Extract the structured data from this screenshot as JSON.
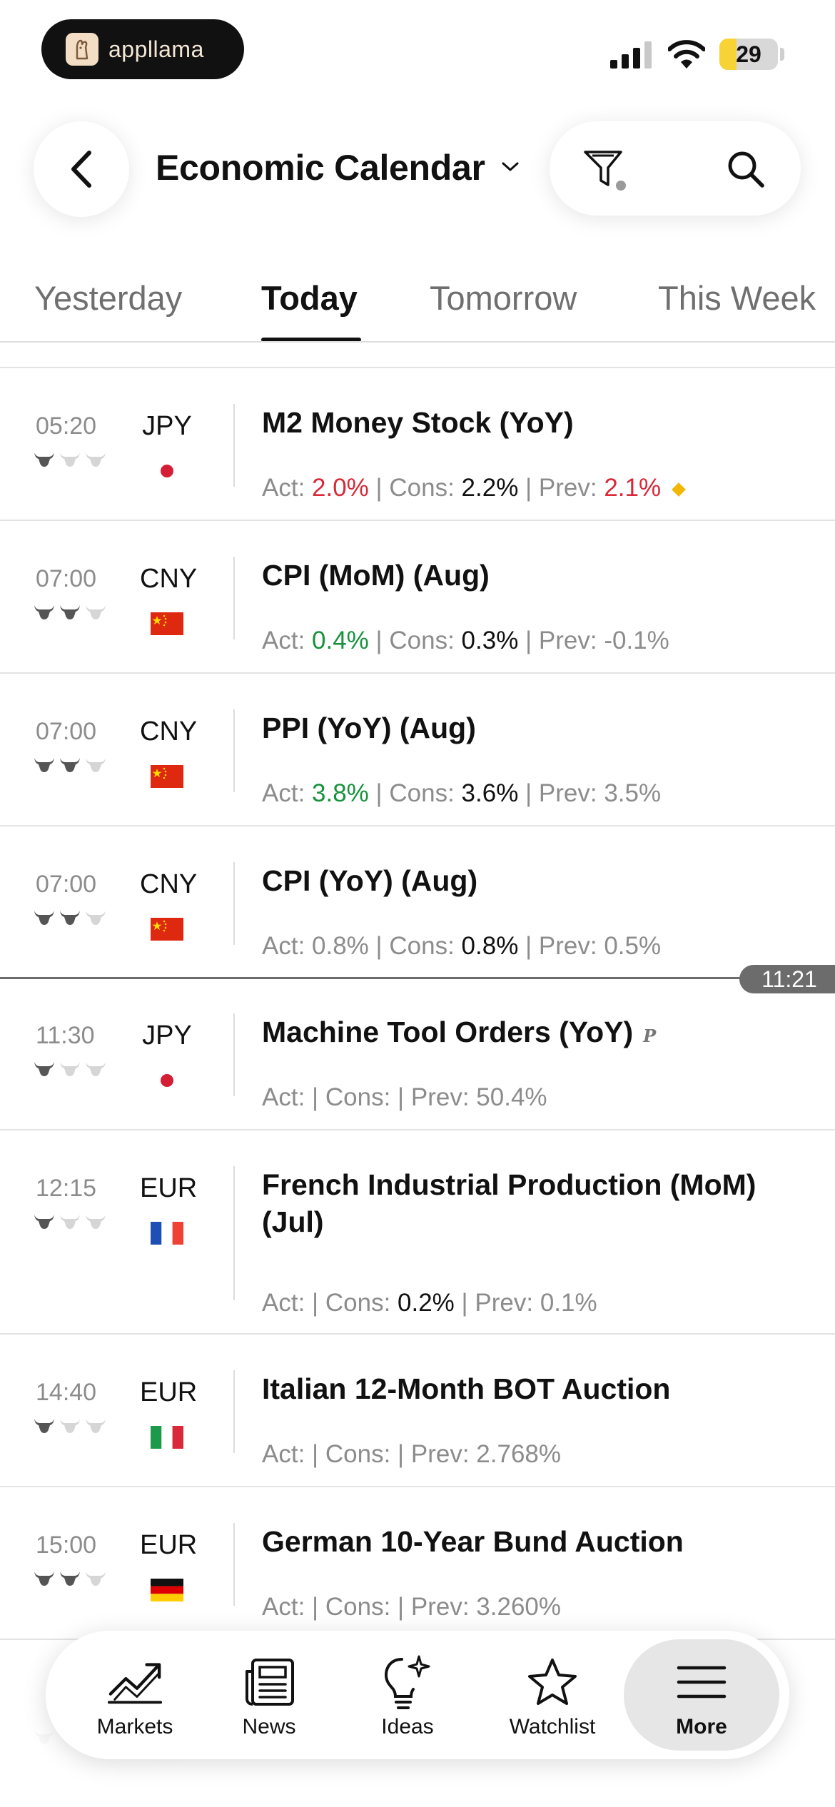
{
  "status_bar": {
    "app_name": "appllama",
    "battery_level": 29,
    "battery_text": "29",
    "battery_color": "#f8d335"
  },
  "header": {
    "title": "Economic Calendar",
    "back_icon": "chevron-left-icon",
    "filter_icon": "funnel-icon",
    "search_icon": "magnifier-icon"
  },
  "tabs": [
    {
      "label": "Yesterday",
      "active": false
    },
    {
      "label": "Today",
      "active": true
    },
    {
      "label": "Tomorrow",
      "active": false
    },
    {
      "label": "This Week",
      "active": false
    }
  ],
  "labels": {
    "act": "Act:",
    "cons": "Cons:",
    "prev": "Prev:",
    "sep": "|"
  },
  "colors": {
    "positive": "#16923c",
    "negative": "#d92837",
    "forecast_mark": "#f2b705"
  },
  "events": [
    {
      "time": "05:20",
      "importance": 1,
      "currency": "JPY",
      "flag": "jp",
      "title": "M2 Money Stock (YoY)",
      "actual": "2.0%",
      "actual_tone": "red",
      "consensus": "2.2%",
      "previous": "2.1%",
      "previous_tone": "red",
      "diamond": true
    },
    {
      "time": "07:00",
      "importance": 2,
      "currency": "CNY",
      "flag": "cn",
      "title": "CPI (MoM) (Aug)",
      "actual": "0.4%",
      "actual_tone": "green",
      "consensus": "0.3%",
      "previous": "-0.1%",
      "previous_tone": "gray"
    },
    {
      "time": "07:00",
      "importance": 2,
      "currency": "CNY",
      "flag": "cn",
      "title": "PPI (YoY) (Aug)",
      "actual": "3.8%",
      "actual_tone": "green",
      "consensus": "3.6%",
      "previous": "3.5%",
      "previous_tone": "gray"
    },
    {
      "time": "07:00",
      "importance": 2,
      "currency": "CNY",
      "flag": "cn",
      "title": "CPI (YoY) (Aug)",
      "actual": "0.8%",
      "actual_tone": "gray",
      "consensus": "0.8%",
      "previous": "0.5%",
      "previous_tone": "gray"
    },
    {
      "time": "11:30",
      "importance": 1,
      "currency": "JPY",
      "flag": "jp",
      "title": "Machine Tool Orders (YoY)",
      "preliminary": "P",
      "actual": "",
      "consensus": "",
      "previous": "50.4%",
      "previous_tone": "gray"
    },
    {
      "time": "12:15",
      "importance": 1,
      "currency": "EUR",
      "flag": "fr",
      "title": "French Industrial Production (MoM) (Jul)",
      "actual": "",
      "consensus": "0.2%",
      "previous": "0.1%",
      "previous_tone": "gray"
    },
    {
      "time": "14:40",
      "importance": 1,
      "currency": "EUR",
      "flag": "it",
      "title": "Italian 12-Month BOT Auction",
      "actual": "",
      "consensus": "",
      "previous": "2.768%",
      "previous_tone": "gray"
    },
    {
      "time": "15:00",
      "importance": 2,
      "currency": "EUR",
      "flag": "de",
      "title": "German 10-Year Bund Auction",
      "actual": "",
      "consensus": "",
      "previous": "3.260%",
      "previous_tone": "gray"
    }
  ],
  "now_marker": {
    "time": "11:21"
  },
  "bottom_nav": [
    {
      "label": "Markets",
      "icon": "chart-trend-icon"
    },
    {
      "label": "News",
      "icon": "newspaper-icon"
    },
    {
      "label": "Ideas",
      "icon": "lightbulb-sparkle-icon"
    },
    {
      "label": "Watchlist",
      "icon": "star-icon"
    },
    {
      "label": "More",
      "icon": "menu-icon",
      "active": true
    }
  ]
}
